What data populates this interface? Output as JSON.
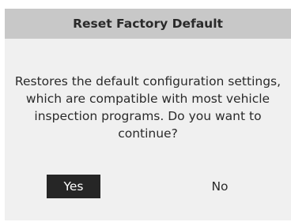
{
  "dialog": {
    "title": "Reset Factory Default",
    "message": "Restores the default configuration settings, which are compatible with most vehicle inspection programs. Do you want to continue?",
    "buttons": {
      "yes_label": "Yes",
      "no_label": "No",
      "selected": "Yes"
    }
  },
  "colors": {
    "title_bar_bg": "#c8c8c8",
    "dialog_bg": "#f0f0f0",
    "selected_button_bg": "#262626",
    "selected_button_text": "#ffffff",
    "text": "#2a2a2a"
  }
}
